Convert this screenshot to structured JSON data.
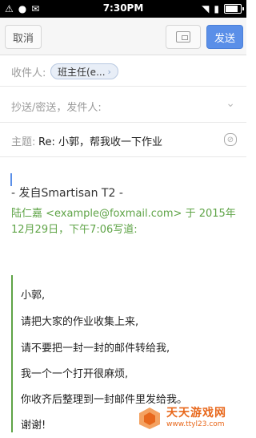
{
  "status_bar": {
    "time": "7:30PM"
  },
  "toolbar": {
    "cancel_label": "取消",
    "send_label": "发送",
    "accent_color": "#5a8fe8"
  },
  "to_row": {
    "label": "收件人:",
    "recipient": "班主任(e..."
  },
  "cc_row": {
    "label": "抄送/密送，发件人:"
  },
  "subject_row": {
    "label": "主题:",
    "value": "Re: 小郭，帮我收一下作业"
  },
  "body": {
    "signature": "- 发自Smartisan T2 -",
    "quote_header": "陆仁嘉 <example@foxmail.com> 于 2015年12月29日，下午7:06写道:",
    "quote_color": "#5fa447",
    "quote_lines": [
      "小郭,",
      "请把大家的作业收集上来,",
      "请不要把一封一封的邮件转给我,",
      "我一个一个打开很麻烦,",
      "你收齐后整理到一封邮件里发给我。",
      "谢谢!"
    ]
  },
  "watermark": {
    "name": "天天游戏网",
    "url": "www.ttyl23.com"
  }
}
